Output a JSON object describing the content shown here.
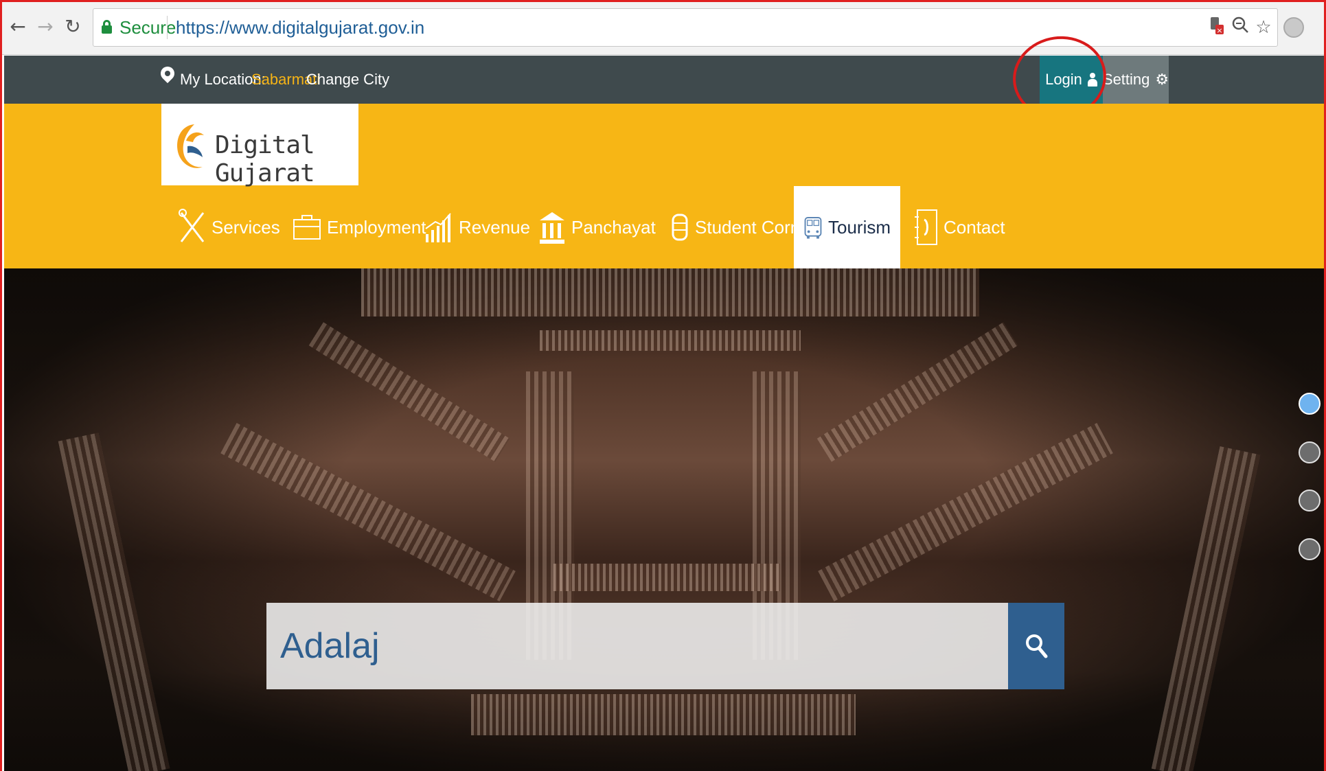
{
  "browser": {
    "secure_label": "Secure",
    "url": "https://www.digitalgujarat.gov.in"
  },
  "topbar": {
    "location_label": "My Location:",
    "location_city": "Sabarmati",
    "change_city_label": "Change City",
    "login_label": "Login",
    "setting_label": "Setting"
  },
  "header": {
    "logo_text": "Digital Gujarat"
  },
  "menu": [
    {
      "label": "Services",
      "icon": "tools-icon"
    },
    {
      "label": "Employment",
      "icon": "briefcase-icon"
    },
    {
      "label": "Revenue",
      "icon": "bar-chart-icon"
    },
    {
      "label": "Panchayat",
      "icon": "building-icon"
    },
    {
      "label": "Student Corner",
      "icon": "student-icon"
    },
    {
      "label": "Tourism",
      "icon": "bus-icon",
      "active": true
    },
    {
      "label": "Contact",
      "icon": "contact-book-icon"
    }
  ],
  "search": {
    "value": "Adalaj"
  },
  "colors": {
    "header_yellow": "#f7b615",
    "topbar_dark": "#3f4a4d",
    "login_teal": "#17757f",
    "search_blue": "#2f5f8f",
    "highlight_red": "#d81b1b"
  }
}
